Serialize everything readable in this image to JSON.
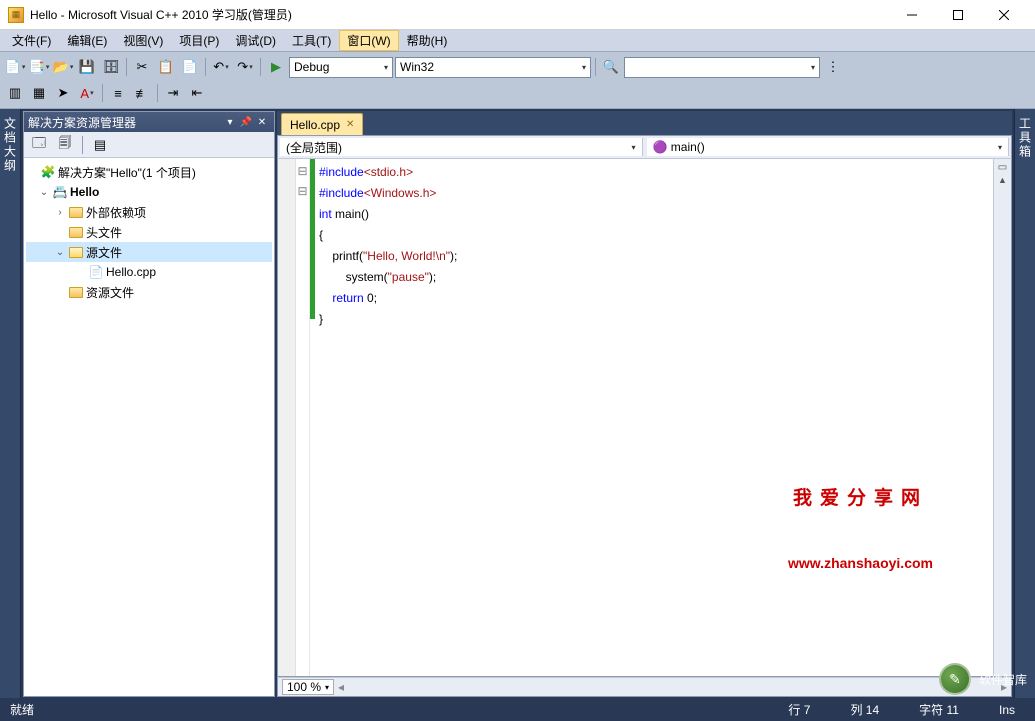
{
  "window": {
    "title": "Hello - Microsoft Visual C++ 2010 学习版(管理员)"
  },
  "menu": {
    "file": "文件(F)",
    "edit": "编辑(E)",
    "view": "视图(V)",
    "project": "项目(P)",
    "debug": "调试(D)",
    "tools": "工具(T)",
    "window": "窗口(W)",
    "help": "帮助(H)"
  },
  "toolbar": {
    "config": "Debug",
    "platform": "Win32"
  },
  "side_tabs": {
    "left": "文档大纲",
    "right": "工具箱"
  },
  "solution_explorer": {
    "title": "解决方案资源管理器",
    "root": "解决方案\"Hello\"(1 个项目)",
    "project": "Hello",
    "folders": {
      "external": "外部依赖项",
      "headers": "头文件",
      "sources": "源文件",
      "resources": "资源文件"
    },
    "file": "Hello.cpp"
  },
  "editor": {
    "tab": "Hello.cpp",
    "scope": "(全局范围)",
    "member": "main()",
    "zoom": "100 %",
    "code": {
      "l1_pre": "#include",
      "l1_inc": "<stdio.h>",
      "l2_pre": "#include",
      "l2_inc": "<Windows.h>",
      "l3_a": "int",
      "l3_b": " main()",
      "l4": "{",
      "l5_a": "    printf(",
      "l5_b": "\"Hello, World!\\n\"",
      "l5_c": ");",
      "l6_a": "        system(",
      "l6_b": "\"pause\"",
      "l6_c": ");",
      "l7_a": "    ",
      "l7_b": "return",
      "l7_c": " 0;",
      "l8": "}"
    }
  },
  "watermark": {
    "line1": "我爱分享网",
    "line2": "www.zhanshaoyi.com"
  },
  "publisher": "软件智库",
  "status": {
    "ready": "就绪",
    "line_lbl": "行",
    "line_val": "7",
    "col_lbl": "列",
    "col_val": "14",
    "char_lbl": "字符",
    "char_val": "11",
    "ins": "Ins"
  }
}
